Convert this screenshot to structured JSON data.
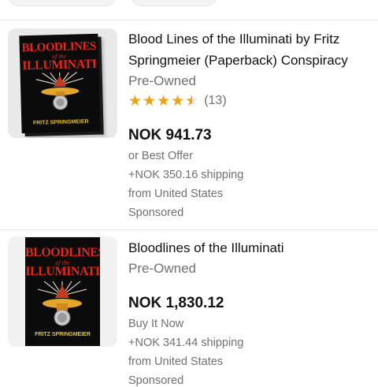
{
  "listings": [
    {
      "title": "Blood Lines of the Illuminati by Fritz Springmeier (Paperback) Conspiracy",
      "condition": "Pre-Owned",
      "rating": 4.5,
      "review_count": "(13)",
      "price": "NOK 941.73",
      "buying_option": "or Best Offer",
      "shipping": "+NOK 350.16 shipping",
      "location": "from United States",
      "tag": "Sponsored",
      "image": {
        "title_line1": "BLOODLINES",
        "title_line2": "of the",
        "title_line3": "ILLUMINATI",
        "author": "FRITZ SPRINGMEIER"
      }
    },
    {
      "title": "Bloodlines of the Illuminati",
      "condition": "Pre-Owned",
      "price": "NOK 1,830.12",
      "buying_option": "Buy It Now",
      "shipping": "+NOK 341.44 shipping",
      "location": "from United States",
      "tag": "Sponsored",
      "image": {
        "title_line1": "BLOODLINES",
        "title_line2": "of the",
        "title_line3": "ILLUMINATI",
        "author": "FRITZ SPRINGMEIER"
      }
    }
  ],
  "colors": {
    "star": "#e9a21b",
    "book_red": "#e8261a",
    "book_gold": "#f0c419"
  }
}
